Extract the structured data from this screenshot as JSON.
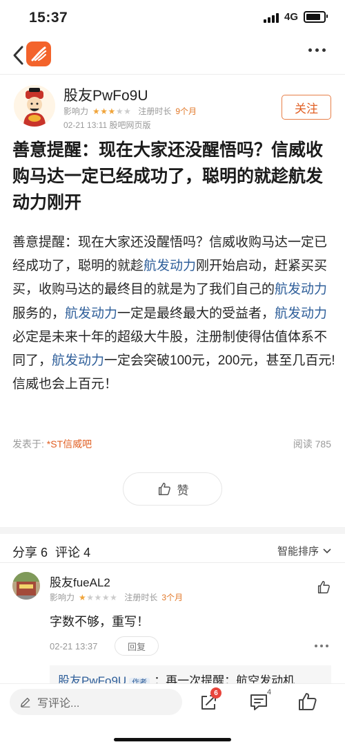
{
  "status_bar": {
    "time": "15:37",
    "network": "4G",
    "battery_level": 0.85
  },
  "colors": {
    "accent": "#e15f23",
    "link": "#2f5f9a",
    "star": "#f0a43a"
  },
  "author": {
    "name": "股友PwFo9U",
    "influence_label": "影响力",
    "stars_filled": 3,
    "stars_total": 5,
    "register_label": "注册时长",
    "register_value": "9个月",
    "date": "02-21 13:11",
    "source_platform": "股吧网页版",
    "follow_label": "关注"
  },
  "post": {
    "title": "善意提醒：现在大家还没醒悟吗？信威收购马达一定已经成功了，聪明的就趁航发动力刚开",
    "body": [
      {
        "t": "善意提醒：现在大家还没醒悟吗？信威收购马达一定已经成功了，聪明的就趁"
      },
      {
        "t": "航发动力",
        "kw": true
      },
      {
        "t": "刚开始启动，赶紧买买买，收购马达的最终目的就是为了我们自己的"
      },
      {
        "t": "航发动力",
        "kw": true
      },
      {
        "t": "服务的，"
      },
      {
        "t": "航发动力",
        "kw": true
      },
      {
        "t": "一定是最终最大的受益者，"
      },
      {
        "t": "航发动力",
        "kw": true
      },
      {
        "t": "必定是未来十年的超级大牛股，注册制使得估值体系不同了，"
      },
      {
        "t": "航发动力",
        "kw": true
      },
      {
        "t": "一定会突破100元，200元，甚至几百元!信威也会上百元！"
      }
    ],
    "posted_in_label": "发表于:",
    "bar_name": "*ST信威吧",
    "read_label": "阅读",
    "read_count": "785",
    "like_label": "赞"
  },
  "stats": {
    "share_label": "分享",
    "share_count": "6",
    "comment_label": "评论",
    "comment_count": "4",
    "sort_label": "智能排序"
  },
  "comment": {
    "name": "股友fueAL2",
    "influence_label": "影响力",
    "stars_filled": 1,
    "stars_total": 5,
    "register_label": "注册时长",
    "register_value": "3个月",
    "text": "字数不够，重写！",
    "date": "02-21 13:37",
    "reply_label": "回复",
    "sub_reply": {
      "author": "股友PwFo9U",
      "tag": "作者",
      "text": "：再一次提醒：航空发动机"
    }
  },
  "bottom_bar": {
    "write_placeholder": "写评论...",
    "share_badge": "6",
    "comment_count": "4"
  }
}
